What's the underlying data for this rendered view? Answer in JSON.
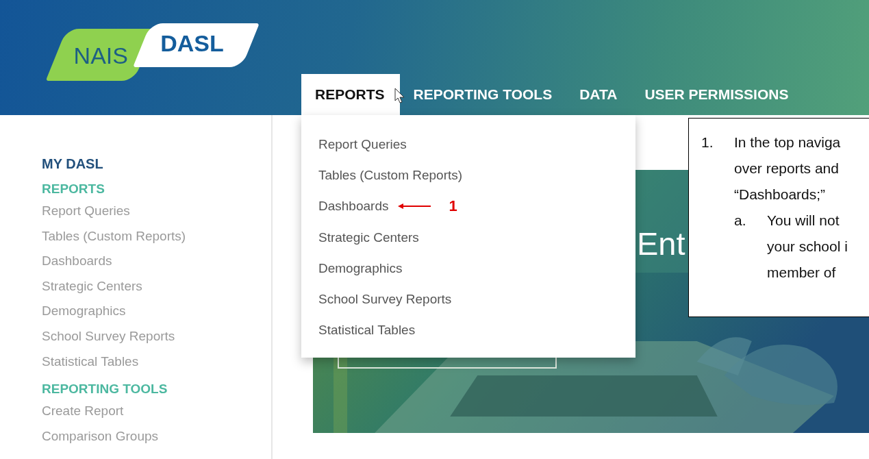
{
  "header": {
    "logo": {
      "left": "NAIS",
      "right": "DASL"
    },
    "nav": [
      {
        "label": "REPORTS",
        "selected": true
      },
      {
        "label": "REPORTING TOOLS",
        "selected": false
      },
      {
        "label": "DATA",
        "selected": false
      },
      {
        "label": "USER PERMISSIONS",
        "selected": false
      }
    ]
  },
  "dropdown": {
    "items": [
      {
        "label": "Report Queries",
        "annotated": false
      },
      {
        "label": "Tables (Custom Reports)",
        "annotated": false
      },
      {
        "label": "Dashboards",
        "annotated": true
      },
      {
        "label": "Strategic Centers",
        "annotated": false
      },
      {
        "label": "Demographics",
        "annotated": false
      },
      {
        "label": "School Survey Reports",
        "annotated": false
      },
      {
        "label": "Statistical Tables",
        "annotated": false
      }
    ]
  },
  "annotation": {
    "marker": "1"
  },
  "sidebar": {
    "title": "MY DASL",
    "sections": [
      {
        "heading": "REPORTS",
        "items": [
          "Report Queries",
          "Tables (Custom Reports)",
          "Dashboards",
          "Strategic Centers",
          "Demographics",
          "School Survey Reports",
          "Statistical Tables"
        ]
      },
      {
        "heading": "REPORTING TOOLS",
        "items": [
          "Create Report",
          "Comparison Groups"
        ]
      }
    ]
  },
  "hero": {
    "kind": "picture",
    "heading": "Ent"
  },
  "callout": {
    "steps": [
      {
        "number": "1.",
        "lines": [
          "In the top naviga",
          "over reports and",
          "“Dashboards;”"
        ],
        "substeps": [
          {
            "letter": "a.",
            "lines": [
              "You will not",
              "your school i",
              "member of"
            ]
          }
        ]
      }
    ]
  }
}
